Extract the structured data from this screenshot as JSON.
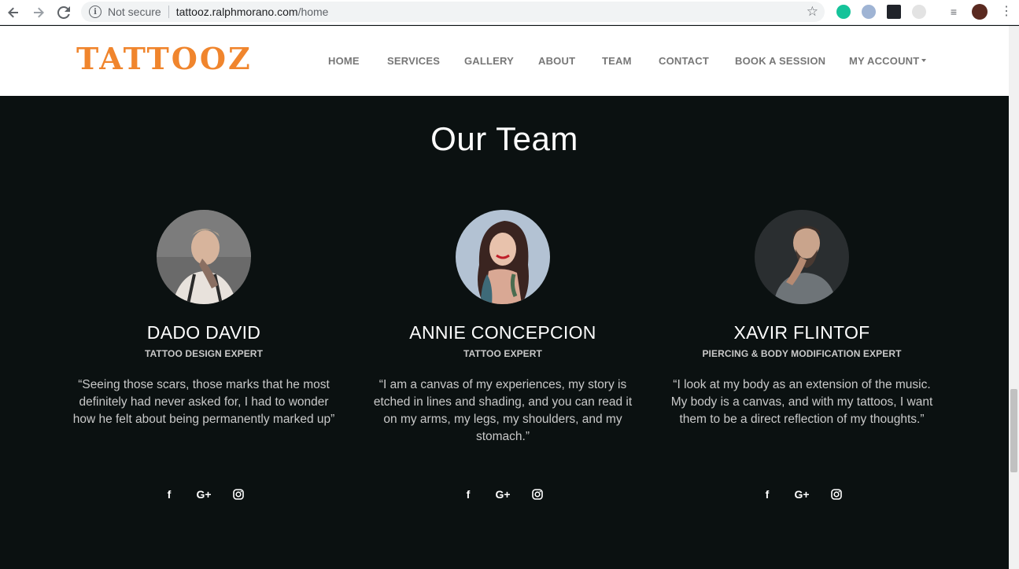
{
  "browser": {
    "security_label": "Not secure",
    "url_host": "tattooz.ralphmorano.com",
    "url_path": "/home"
  },
  "site": {
    "logo_text": "TATTOOZ",
    "nav": [
      {
        "label": "HOME"
      },
      {
        "label": "SERVICES"
      },
      {
        "label": "GALLERY"
      },
      {
        "label": "ABOUT"
      },
      {
        "label": "TEAM"
      },
      {
        "label": "CONTACT"
      },
      {
        "label": "BOOK A SESSION"
      },
      {
        "label": "MY ACCOUNT"
      }
    ],
    "accent_color": "#f0852d"
  },
  "team": {
    "title": "Our Team",
    "members": [
      {
        "name": "DADO DAVID",
        "role": "TATTOO DESIGN EXPERT",
        "quote": "“Seeing those scars, those marks that he most definitely had never asked for, I had to wonder how he felt about being permanently marked up”"
      },
      {
        "name": "ANNIE CONCEPCION",
        "role": "TATTOO EXPERT",
        "quote": "“I am a canvas of my experiences, my story is etched in lines and shading, and you can read it on my arms, my legs, my shoulders, and my stomach.”"
      },
      {
        "name": "XAVIR FLINTOF",
        "role": "PIERCING & BODY MODIFICATION EXPERT",
        "quote": "“I look at my body as an extension of the music. My body is a canvas, and with my tattoos, I want them to be a direct reflection of my thoughts.”"
      }
    ],
    "social_icons": [
      "facebook-icon",
      "google-plus-icon",
      "instagram-icon"
    ]
  }
}
